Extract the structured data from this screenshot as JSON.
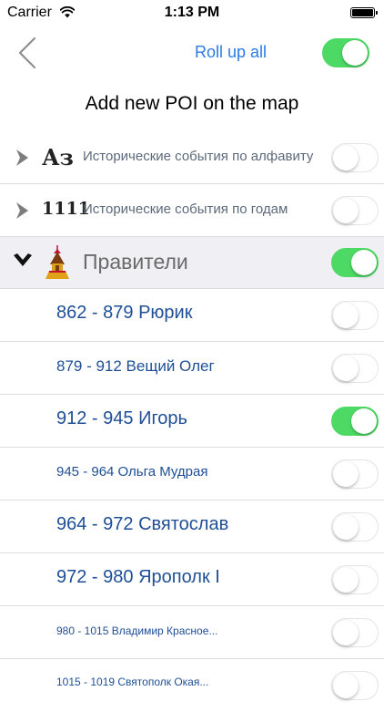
{
  "status": {
    "carrier": "Carrier",
    "time": "1:13 PM"
  },
  "nav": {
    "rollup": "Roll up all",
    "master_switch_on": true
  },
  "title": "Add new POI on the map",
  "groups": [
    {
      "icon_text": "Аз",
      "label": "Исторические события по алфавиту",
      "expanded": false,
      "on": false
    },
    {
      "icon_text": "1111",
      "label": "Исторические события по годам",
      "expanded": false,
      "on": false
    },
    {
      "icon": "kremlin-tower-icon",
      "label": "Правители",
      "expanded": true,
      "on": true
    }
  ],
  "rulers": [
    {
      "label": "862 - 879 Рюрик",
      "on": false
    },
    {
      "label": "879 - 912 Вещий Олег",
      "on": false
    },
    {
      "label": "912 - 945 Игорь",
      "on": true
    },
    {
      "label": "945 - 964 Ольга Мудрая",
      "on": false
    },
    {
      "label": "964 - 972 Святослав",
      "on": false
    },
    {
      "label": "972 - 980 Ярополк I",
      "on": false
    },
    {
      "label": "980 - 1015 Владимир Красное...",
      "on": false
    },
    {
      "label": "1015 - 1019 Святополк Окая...",
      "on": false
    }
  ],
  "colors": {
    "accent": "#2a7be4",
    "switch_on": "#4cd964",
    "ruler_text": "#1e4f96",
    "group_text": "#5d6a7a",
    "selected_row_bg": "#efeff4"
  }
}
